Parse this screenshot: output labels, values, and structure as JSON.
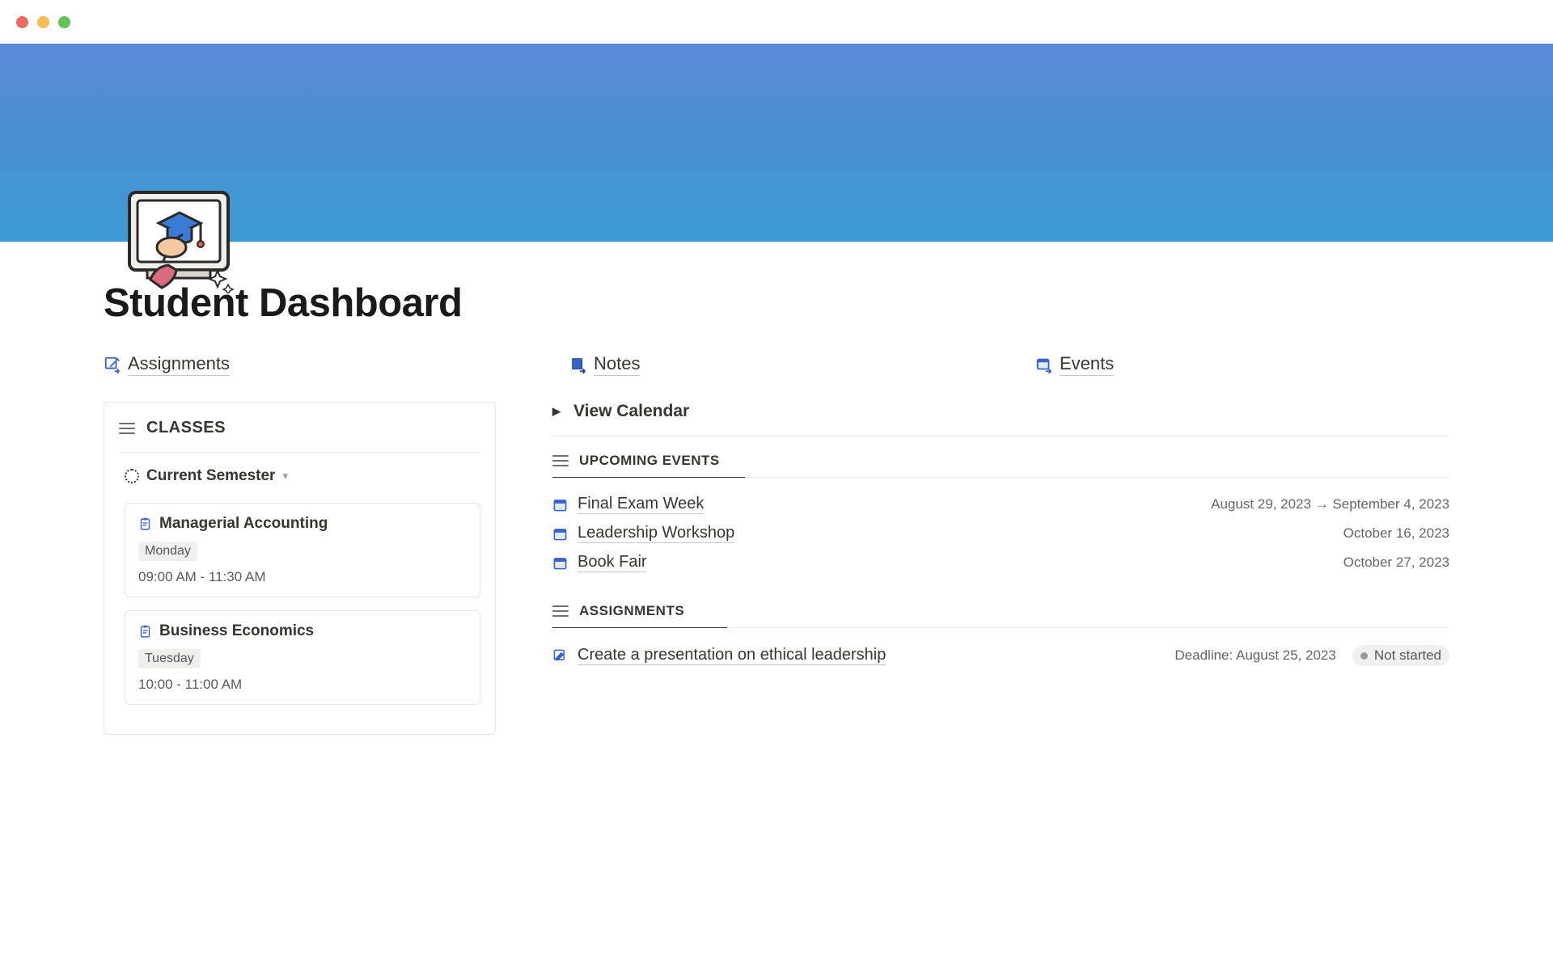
{
  "page": {
    "title": "Student Dashboard"
  },
  "nav": {
    "assignments": "Assignments",
    "notes": "Notes",
    "events": "Events"
  },
  "classes": {
    "heading": "CLASSES",
    "semester": "Current Semester",
    "items": [
      {
        "name": "Managerial Accounting",
        "day": "Monday",
        "time": "09:00 AM - 11:30 AM"
      },
      {
        "name": "Business Economics",
        "day": "Tuesday",
        "time": "10:00 - 11:00 AM"
      }
    ]
  },
  "calendar": {
    "view": "View Calendar"
  },
  "upcoming": {
    "heading": "UPCOMING EVENTS",
    "items": [
      {
        "title": "Final Exam Week",
        "date": "August 29, 2023 → September 4, 2023"
      },
      {
        "title": "Leadership Workshop",
        "date": "October 16, 2023"
      },
      {
        "title": "Book Fair",
        "date": "October 27, 2023"
      }
    ]
  },
  "assignments": {
    "heading": "ASSIGNMENTS",
    "items": [
      {
        "title": "Create a presentation on ethical leadership",
        "deadline": "Deadline: August 25, 2023",
        "status": "Not started"
      }
    ]
  }
}
